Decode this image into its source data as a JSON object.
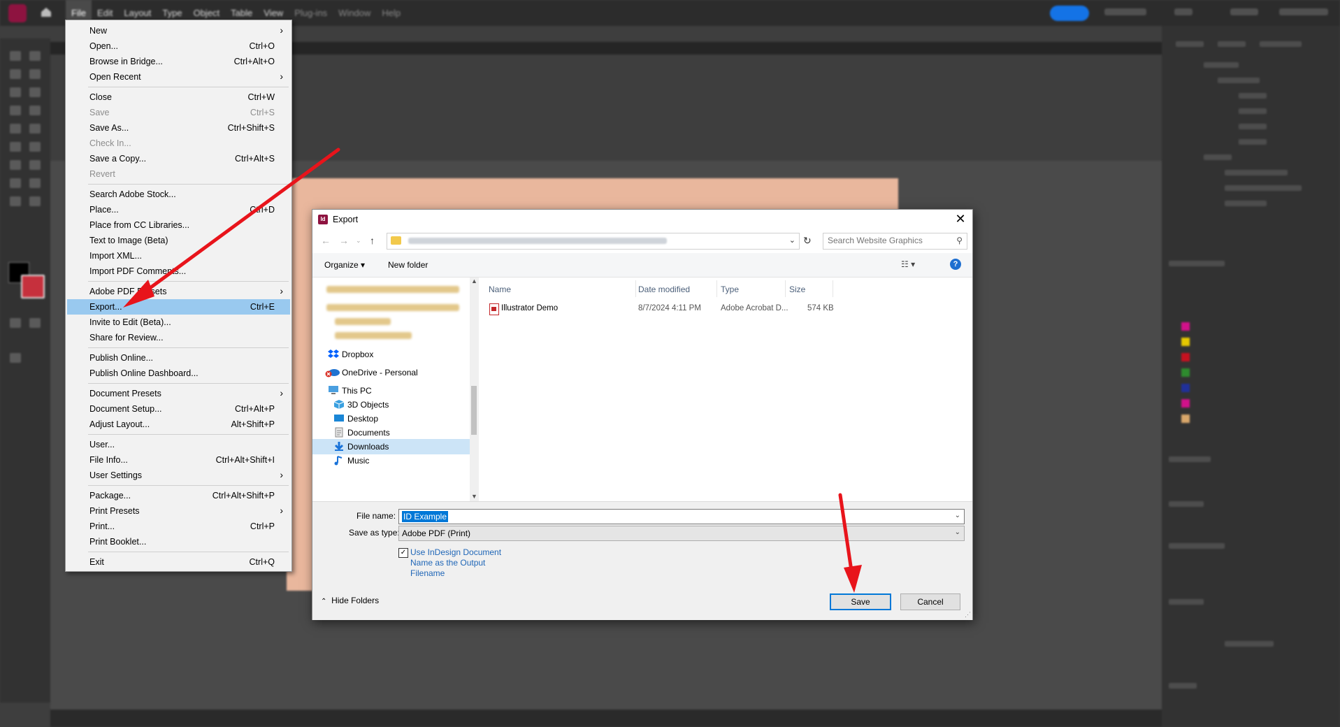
{
  "app": {
    "menubar": [
      "File",
      "Edit",
      "Layout",
      "Type",
      "Object",
      "Table",
      "View",
      "Plug-ins",
      "Window",
      "Help"
    ]
  },
  "file_menu": {
    "items": [
      {
        "label": "New",
        "shortcut": "",
        "submenu": true,
        "disabled": false
      },
      {
        "label": "Open...",
        "shortcut": "Ctrl+O",
        "submenu": false,
        "disabled": false
      },
      {
        "label": "Browse in Bridge...",
        "shortcut": "Ctrl+Alt+O",
        "submenu": false,
        "disabled": false
      },
      {
        "label": "Open Recent",
        "shortcut": "",
        "submenu": true,
        "disabled": false
      },
      {
        "label": "Close",
        "shortcut": "Ctrl+W",
        "submenu": false,
        "disabled": false
      },
      {
        "label": "Save",
        "shortcut": "Ctrl+S",
        "submenu": false,
        "disabled": true
      },
      {
        "label": "Save As...",
        "shortcut": "Ctrl+Shift+S",
        "submenu": false,
        "disabled": false
      },
      {
        "label": "Check In...",
        "shortcut": "",
        "submenu": false,
        "disabled": true
      },
      {
        "label": "Save a Copy...",
        "shortcut": "Ctrl+Alt+S",
        "submenu": false,
        "disabled": false
      },
      {
        "label": "Revert",
        "shortcut": "",
        "submenu": false,
        "disabled": true
      },
      {
        "label": "Search Adobe Stock...",
        "shortcut": "",
        "submenu": false,
        "disabled": false
      },
      {
        "label": "Place...",
        "shortcut": "Ctrl+D",
        "submenu": false,
        "disabled": false
      },
      {
        "label": "Place from CC Libraries...",
        "shortcut": "",
        "submenu": false,
        "disabled": false
      },
      {
        "label": "Text to Image (Beta)",
        "shortcut": "",
        "submenu": false,
        "disabled": false
      },
      {
        "label": "Import XML...",
        "shortcut": "",
        "submenu": false,
        "disabled": false
      },
      {
        "label": "Import PDF Comments...",
        "shortcut": "",
        "submenu": false,
        "disabled": false
      },
      {
        "label": "Adobe PDF Presets",
        "shortcut": "",
        "submenu": true,
        "disabled": false
      },
      {
        "label": "Export...",
        "shortcut": "Ctrl+E",
        "submenu": false,
        "disabled": false
      },
      {
        "label": "Invite to Edit (Beta)...",
        "shortcut": "",
        "submenu": false,
        "disabled": false
      },
      {
        "label": "Share for Review...",
        "shortcut": "",
        "submenu": false,
        "disabled": false
      },
      {
        "label": "Publish Online...",
        "shortcut": "",
        "submenu": false,
        "disabled": false
      },
      {
        "label": "Publish Online Dashboard...",
        "shortcut": "",
        "submenu": false,
        "disabled": false
      },
      {
        "label": "Document Presets",
        "shortcut": "",
        "submenu": true,
        "disabled": false
      },
      {
        "label": "Document Setup...",
        "shortcut": "Ctrl+Alt+P",
        "submenu": false,
        "disabled": false
      },
      {
        "label": "Adjust Layout...",
        "shortcut": "Alt+Shift+P",
        "submenu": false,
        "disabled": false
      },
      {
        "label": "User...",
        "shortcut": "",
        "submenu": false,
        "disabled": false
      },
      {
        "label": "File Info...",
        "shortcut": "Ctrl+Alt+Shift+I",
        "submenu": false,
        "disabled": false
      },
      {
        "label": "User Settings",
        "shortcut": "",
        "submenu": true,
        "disabled": false
      },
      {
        "label": "Package...",
        "shortcut": "Ctrl+Alt+Shift+P",
        "submenu": false,
        "disabled": false
      },
      {
        "label": "Print Presets",
        "shortcut": "",
        "submenu": true,
        "disabled": false
      },
      {
        "label": "Print...",
        "shortcut": "Ctrl+P",
        "submenu": false,
        "disabled": false
      },
      {
        "label": "Print Booklet...",
        "shortcut": "",
        "submenu": false,
        "disabled": false
      },
      {
        "label": "Exit",
        "shortcut": "Ctrl+Q",
        "submenu": false,
        "disabled": false
      }
    ],
    "highlighted": "Export..."
  },
  "export_dialog": {
    "title": "Export",
    "search_placeholder": "Search Website Graphics",
    "organize_label": "Organize ▾",
    "new_folder_label": "New folder",
    "nav_items": {
      "dropbox": "Dropbox",
      "onedrive": "OneDrive - Personal",
      "this_pc": "This PC",
      "objects3d": "3D Objects",
      "desktop": "Desktop",
      "documents": "Documents",
      "downloads": "Downloads",
      "music": "Music"
    },
    "columns": {
      "name": "Name",
      "date": "Date modified",
      "type": "Type",
      "size": "Size"
    },
    "file": {
      "name": "Illustrator Demo",
      "date": "8/7/2024 4:11 PM",
      "type": "Adobe Acrobat D...",
      "size": "574 KB"
    },
    "file_name_label": "File name:",
    "file_name_value": "ID Example",
    "save_as_type_label": "Save as type:",
    "save_as_type_value": "Adobe PDF (Print)",
    "checkbox_label": "Use InDesign Document Name as the Output Filename",
    "checkbox_checked": true,
    "hide_folders": "Hide Folders",
    "save": "Save",
    "cancel": "Cancel"
  },
  "colors": {
    "accent": "#0078d7",
    "menu_highlight": "#99c9ef",
    "annotation_arrow": "#e8141b",
    "indesign_brand": "#8e1340"
  }
}
